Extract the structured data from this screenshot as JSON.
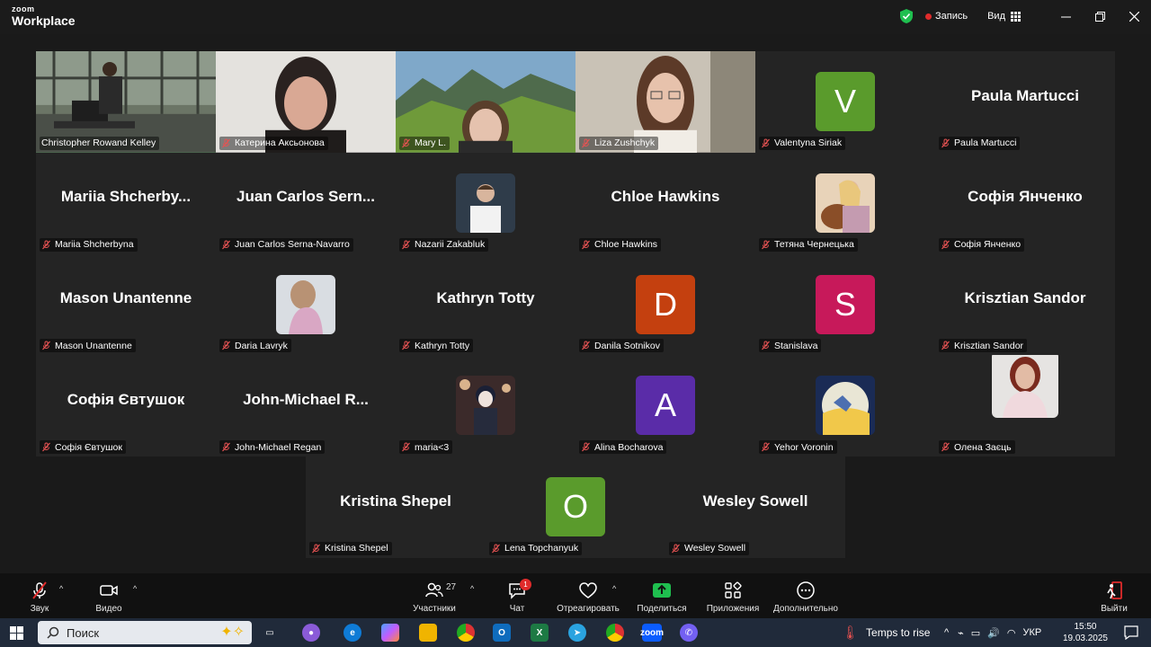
{
  "app": {
    "logo_small": "zoom",
    "logo_big": "Workplace"
  },
  "header": {
    "record_label": "Запись",
    "view_label": "Вид"
  },
  "colors": {
    "active_border": "#3ad05a",
    "record_dot": "#e02b2b",
    "share_green": "#1fbf4f"
  },
  "tiles_top": [
    {
      "name": "Christopher Rowand Kelley",
      "kind": "video",
      "scene": "office",
      "active": true,
      "muted": false
    },
    {
      "name": "Катерина Аксьонова",
      "kind": "video",
      "scene": "woman-light",
      "muted": true
    },
    {
      "name": "Mary L.",
      "kind": "video",
      "scene": "mountains",
      "muted": true
    },
    {
      "name": "Liza Zushchyk",
      "kind": "video",
      "scene": "woman-glasses",
      "muted": true
    },
    {
      "name": "Valentyna Siriak",
      "kind": "letter",
      "letter": "V",
      "color": "#5a9b2c",
      "muted": true
    },
    {
      "name": "Paula Martucci",
      "kind": "name",
      "display": "Paula Martucci",
      "muted": true
    },
    {
      "name": "Mariia Shcherbyna",
      "kind": "name",
      "display": "Mariia  Shcherby...",
      "muted": true
    },
    {
      "name": "Juan Carlos Serna-Navarro",
      "kind": "name",
      "display": "Juan  Carlos  Sern...",
      "muted": true
    },
    {
      "name": "Nazarii Zakabluk",
      "kind": "photo",
      "scene": "boy",
      "muted": true
    },
    {
      "name": "Chloe Hawkins",
      "kind": "name",
      "display": "Chloe Hawkins",
      "muted": true
    },
    {
      "name": "Тетяна Чернецька",
      "kind": "photo",
      "scene": "dog",
      "muted": true
    },
    {
      "name": "Софія Янченко",
      "kind": "name",
      "display": "Софія Янченко",
      "muted": true
    },
    {
      "name": "Mason Unantenne",
      "kind": "name",
      "display": "Mason Unantenne",
      "muted": true
    },
    {
      "name": "Daria Lavryk",
      "kind": "photo",
      "scene": "girl-pink",
      "muted": true
    },
    {
      "name": "Kathryn Totty",
      "kind": "name",
      "display": "Kathryn Totty",
      "muted": true
    },
    {
      "name": "Danila Sotnikov",
      "kind": "letter",
      "letter": "D",
      "color": "#c4400f",
      "muted": true
    },
    {
      "name": "Stanislava",
      "kind": "letter",
      "letter": "S",
      "color": "#c7195a",
      "muted": true
    },
    {
      "name": "Krisztian Sandor",
      "kind": "name",
      "display": "Krisztian Sandor",
      "muted": true
    },
    {
      "name": "Софія Євтушок",
      "kind": "name",
      "display": "Софія Євтушок",
      "muted": true
    },
    {
      "name": "John-Michael Regan",
      "kind": "name",
      "display": "John-Michael  R...",
      "muted": true
    },
    {
      "name": "maria<3",
      "kind": "photo",
      "scene": "anime",
      "muted": true
    },
    {
      "name": "Alina Bocharova",
      "kind": "letter",
      "letter": "A",
      "color": "#5a2ca8",
      "muted": true
    },
    {
      "name": "Yehor Voronin",
      "kind": "photo",
      "scene": "moon",
      "muted": true
    },
    {
      "name": "Олена Заєць",
      "kind": "photo",
      "scene": "woman-red",
      "muted": true
    }
  ],
  "tiles_bottom": [
    {
      "name": "Kristina Shepel",
      "kind": "name",
      "display": "Kristina Shepel",
      "muted": true
    },
    {
      "name": "Lena Topchanyuk",
      "kind": "letter",
      "letter": "O",
      "color": "#5a9b2c",
      "muted": true
    },
    {
      "name": "Wesley Sowell",
      "kind": "name",
      "display": "Wesley Sowell",
      "muted": true
    }
  ],
  "toolbar": {
    "audio": "Звук",
    "video": "Видео",
    "participants": "Участники",
    "participants_count": "27",
    "chat": "Чат",
    "chat_badge": "1",
    "react": "Отреагировать",
    "share": "Поделиться",
    "apps": "Приложения",
    "more": "Дополнительно",
    "leave": "Выйти"
  },
  "taskbar": {
    "search_placeholder": "Поиск",
    "weather": "Temps to rise",
    "lang": "УКР",
    "time": "15:50",
    "date": "19.03.2025"
  }
}
